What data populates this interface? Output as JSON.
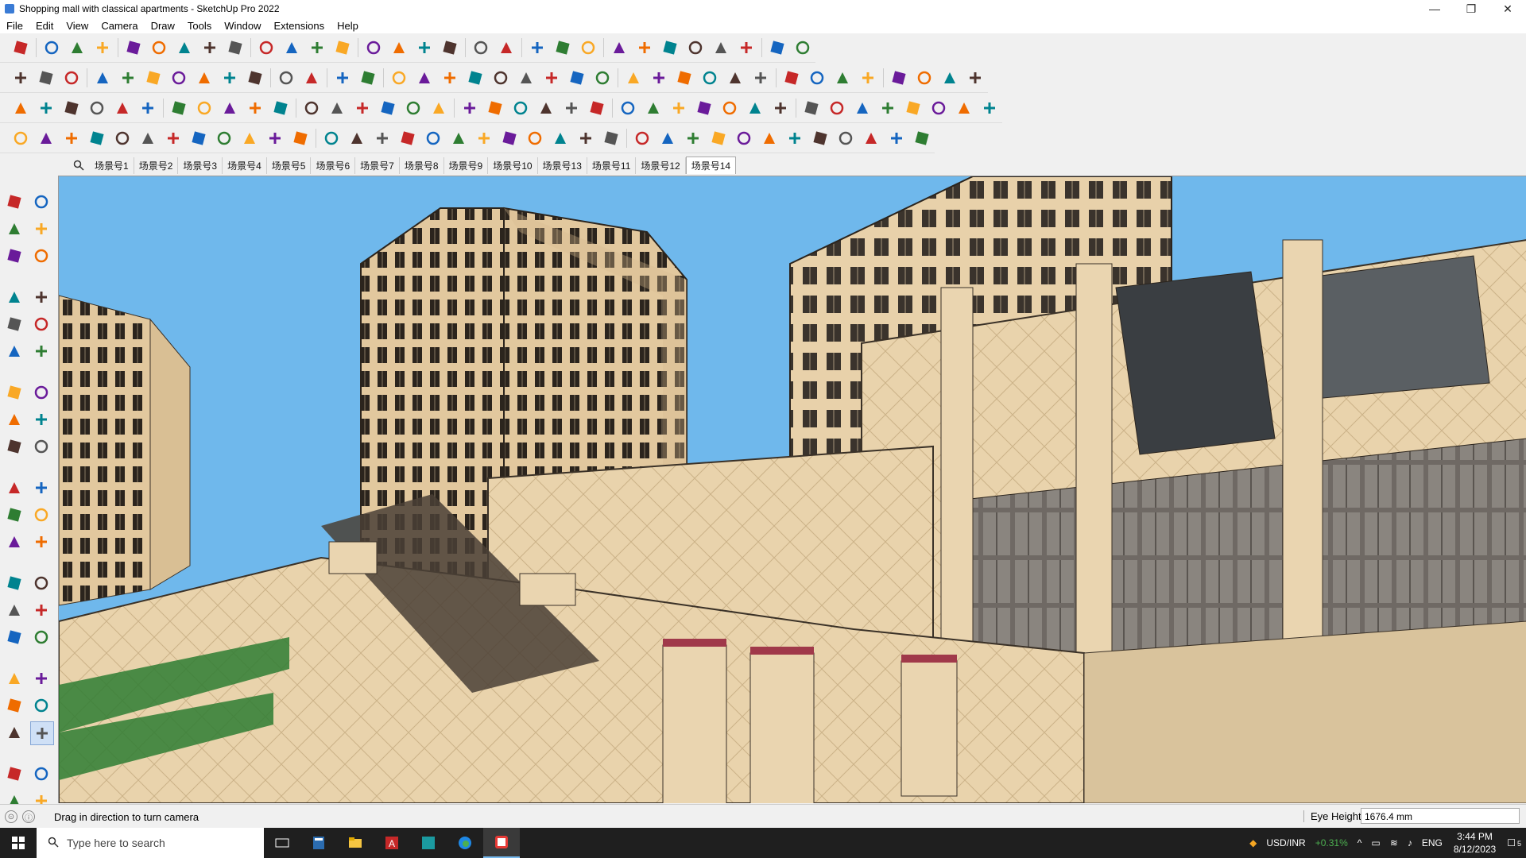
{
  "window": {
    "title": "Shopping mall with classical apartments - SketchUp Pro 2022",
    "minimize": "—",
    "maximize": "❐",
    "close": "✕"
  },
  "menu": [
    "File",
    "Edit",
    "View",
    "Camera",
    "Draw",
    "Tools",
    "Window",
    "Extensions",
    "Help"
  ],
  "scenes": {
    "tabs": [
      "场景号1",
      "场景号2",
      "场景号3",
      "场景号4",
      "场景号5",
      "场景号6",
      "场景号7",
      "场景号8",
      "场景号9",
      "场景号10",
      "场景号13",
      "场景号11",
      "场景号12",
      "场景号14"
    ],
    "active_index": 13
  },
  "status": {
    "hint": "Drag in direction to turn camera",
    "eye_height_label": "Eye Height",
    "eye_height_value": "1676.4 mm"
  },
  "taskbar": {
    "search_placeholder": "Type here to search",
    "currency_label": "USD/INR",
    "currency_change": "+0.31%",
    "language": "ENG",
    "time": "3:44 PM",
    "date": "8/12/2023",
    "notification_count": "5"
  },
  "colors": {
    "sky": "#6fb8ec",
    "stone": "#e6cfa6",
    "dark_stone": "#3a3127",
    "accent_green": "#2e7d32",
    "tab_active": "#ffffff"
  }
}
